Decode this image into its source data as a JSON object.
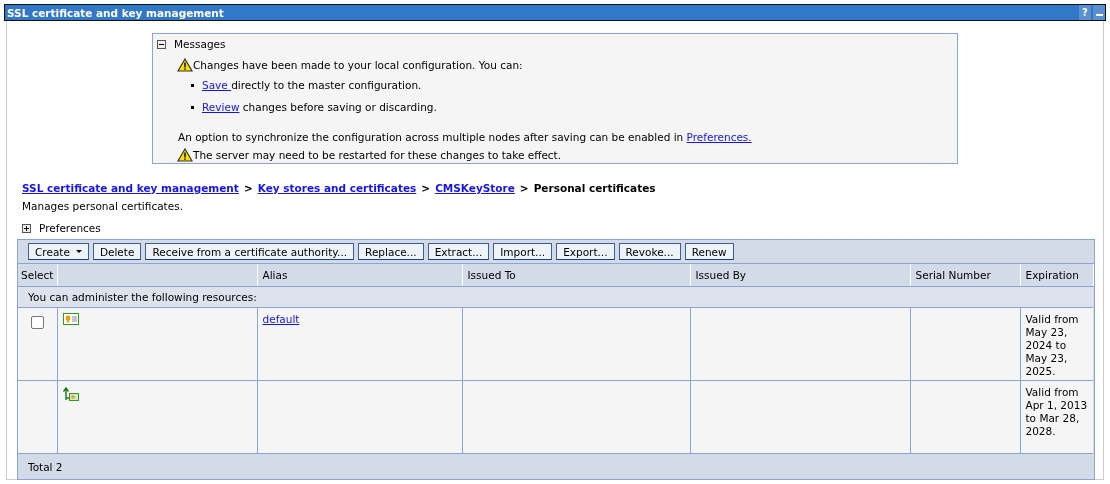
{
  "window": {
    "title": "SSL certificate and key management",
    "help": "?"
  },
  "messages": {
    "title": "Messages",
    "expanded": true,
    "warning": "Changes have been made to your local configuration. You can:",
    "options": [
      {
        "link": "Save ",
        "text": "directly to the master configuration."
      },
      {
        "link": "Review",
        "text": " changes before saving or discarding."
      }
    ],
    "sync": {
      "text": "An option to synchronize the configuration across multiple nodes after saving can be enabled in ",
      "link": "Preferences."
    },
    "restart": "The server may need to be restarted for these changes to take effect."
  },
  "breadcrumb": {
    "links": [
      "SSL certificate and key management",
      "Key stores and certificates",
      "CMSKeyStore"
    ],
    "separator": ">",
    "current": "Personal certificates"
  },
  "description": "Manages personal certificates.",
  "preferences": {
    "title": "Preferences",
    "expanded": false
  },
  "toolbar": [
    {
      "label": "Create",
      "kind": "menu"
    },
    {
      "label": "Delete",
      "kind": "button"
    },
    {
      "label": "Receive from a certificate authority...",
      "kind": "button"
    },
    {
      "label": "Replace...",
      "kind": "button"
    },
    {
      "label": "Extract...",
      "kind": "button"
    },
    {
      "label": "Import...",
      "kind": "button"
    },
    {
      "label": "Export...",
      "kind": "button"
    },
    {
      "label": "Revoke...",
      "kind": "button"
    },
    {
      "label": "Renew",
      "kind": "button"
    }
  ],
  "table": {
    "columns": [
      "Select",
      "",
      "Alias",
      "Issued To",
      "Issued By",
      "Serial Number",
      "Expiration"
    ],
    "resources_note": "You can administer the following resources:",
    "rows": [
      {
        "checked": false,
        "kind": "personal",
        "alias": "default",
        "expiration": "Valid from May 23, 2024 to May 23, 2025."
      },
      {
        "kind": "signer",
        "expiration": "Valid from Apr 1, 2013 to Mar 28, 2028."
      }
    ],
    "total": "Total 2"
  }
}
